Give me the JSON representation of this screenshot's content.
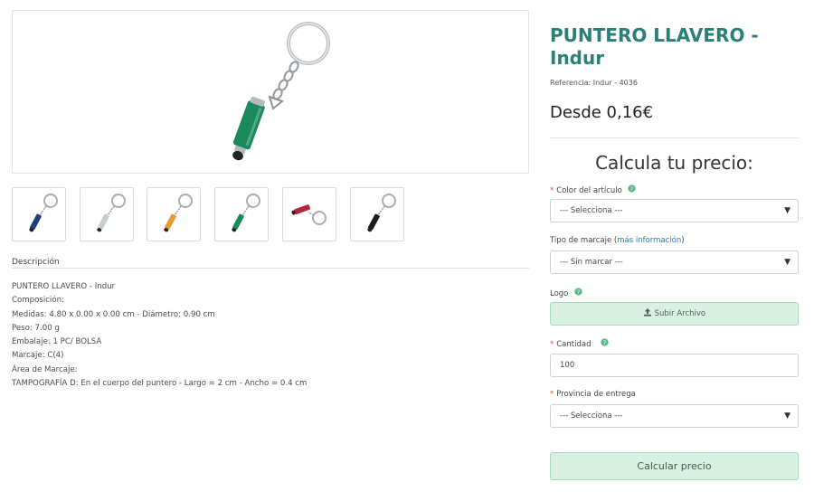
{
  "product": {
    "title_line1": "PUNTERO LLAVERO -",
    "title_line2": "Indur",
    "reference": "Referencia: Indur - 4036",
    "price": "Desde 0,16€"
  },
  "thumbnails": [
    {
      "color_name": "azul",
      "color": "#1f3f7a"
    },
    {
      "color_name": "plata",
      "color": "#c7ccd2"
    },
    {
      "color_name": "naranja",
      "color": "#e69a2e"
    },
    {
      "color_name": "verde",
      "color": "#1a8a5a"
    },
    {
      "color_name": "rojo",
      "color": "#b3273a"
    },
    {
      "color_name": "negro",
      "color": "#1b1b1b"
    }
  ],
  "main_image": {
    "color": "#1a8a5a"
  },
  "description": {
    "heading": "Descripción",
    "lines": [
      "PUNTERO LLAVERO - Indur",
      "Composición:",
      "Medidas: 4.80 x 0.00 x 0.00 cm - Diámetro: 0.90 cm",
      "Peso: 7.00 g",
      "Embalaje: 1 PC/ BOLSA",
      "Marcaje: C(4)",
      "Área de Marcaje:",
      "TAMPOGRAFÍA D: En el cuerpo del puntero - Largo = 2 cm - Ancho = 0.4 cm"
    ]
  },
  "calculator": {
    "heading": "Calcula tu precio:",
    "color_label": "Color del artículo",
    "color_value": "--- Selecciona ---",
    "marcaje_label": "Tipo de marcaje (",
    "marcaje_link": "más información",
    "marcaje_label_end": ")",
    "marcaje_value": "--- Sin marcar ---",
    "logo_label": "Logo",
    "upload_label": "Subir Archivo",
    "cantidad_label": "Cantidad",
    "cantidad_value": "100",
    "provincia_label": "Provincia de entrega",
    "provincia_value": "--- Selecciona ---",
    "submit_label": "Calcular precio",
    "required_mark": "*"
  },
  "icons": {
    "help": "question-circle-icon",
    "upload": "upload-icon",
    "dropdown": "caret-down-icon"
  },
  "colors": {
    "title": "#2a7f7a",
    "button_bg": "#d8f1e3",
    "required": "#d9534f",
    "help": "#5cb88a",
    "link": "#2a7bb5"
  }
}
